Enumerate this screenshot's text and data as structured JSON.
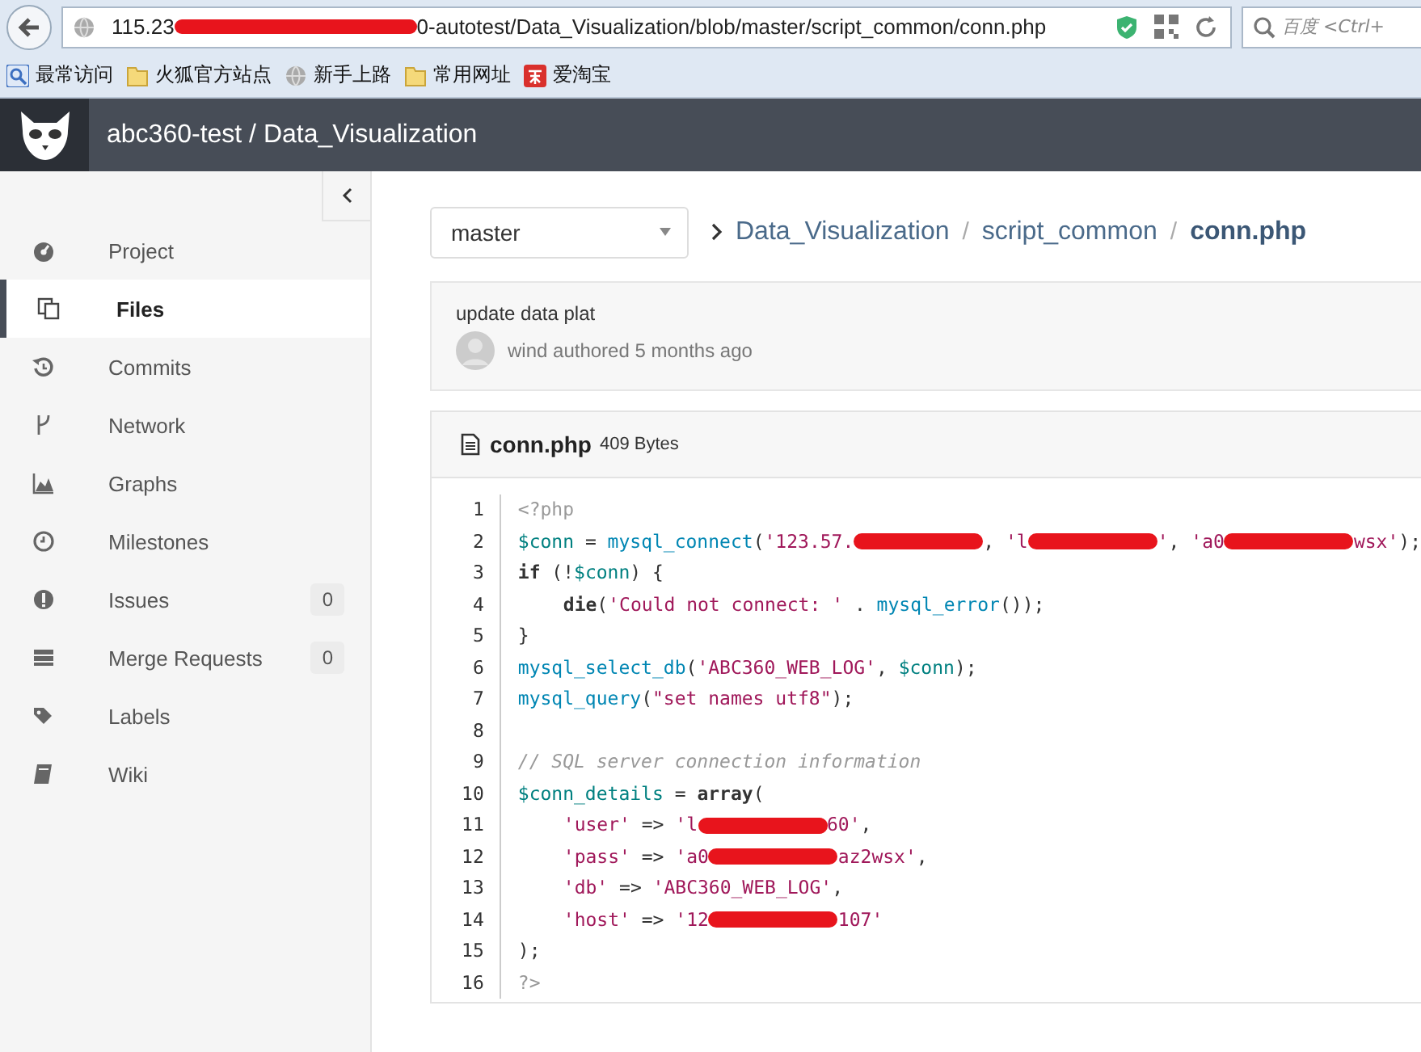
{
  "browser": {
    "address": [
      {
        "kind": "text",
        "text": "115.23"
      },
      {
        "kind": "redacted"
      },
      {
        "kind": "text",
        "text": "0-autotest/Data_Visualization/blob/master/script_common/conn.php"
      }
    ],
    "search": {
      "placeholder": "百度 <Ctrl+"
    },
    "bookmarks": [
      {
        "kind": "search",
        "label": "最常访问"
      },
      {
        "kind": "folder",
        "label": "火狐官方站点"
      },
      {
        "kind": "globe",
        "label": "新手上路"
      },
      {
        "kind": "folder",
        "label": "常用网址"
      },
      {
        "kind": "taobao",
        "label": "爱淘宝"
      }
    ]
  },
  "header": {
    "title": "abc360-test / Data_Visualization"
  },
  "sidebar": {
    "items": [
      {
        "kind": "dashboard",
        "label": "Project",
        "selected": false
      },
      {
        "kind": "files",
        "label": "Files",
        "selected": true
      },
      {
        "kind": "history",
        "label": "Commits",
        "selected": false
      },
      {
        "kind": "fork",
        "label": "Network",
        "selected": false
      },
      {
        "kind": "chart",
        "label": "Graphs",
        "selected": false
      },
      {
        "kind": "clock",
        "label": "Milestones",
        "selected": false
      },
      {
        "kind": "info",
        "label": "Issues",
        "selected": false,
        "count": "0"
      },
      {
        "kind": "list",
        "label": "Merge Requests",
        "selected": false,
        "count": "0"
      },
      {
        "kind": "tags",
        "label": "Labels",
        "selected": false
      },
      {
        "kind": "book",
        "label": "Wiki",
        "selected": false
      }
    ]
  },
  "branch": {
    "value": "master"
  },
  "breadcrumb": [
    {
      "text": "Data_Visualization",
      "current": false
    },
    {
      "separator": "/",
      "text": "script_common",
      "current": false
    },
    {
      "separator": "/",
      "text": "conn.php",
      "current": true
    }
  ],
  "commit": {
    "message": "update data plat",
    "meta": "wind authored 5 months ago"
  },
  "file": {
    "name": "conn.php",
    "size": "409 Bytes",
    "lines": [
      {
        "number": "1",
        "tokens": [
          {
            "kind": "meta",
            "text": "<?php"
          }
        ]
      },
      {
        "number": "2",
        "tokens": [
          {
            "kind": "var",
            "text": "$conn"
          },
          {
            "kind": "plain",
            "text": " = "
          },
          {
            "kind": "func",
            "text": "mysql_connect"
          },
          {
            "kind": "plain",
            "text": "("
          },
          {
            "kind": "string",
            "text": "'123.57."
          },
          {
            "kind": "redacted"
          },
          {
            "kind": "plain",
            "text": ", "
          },
          {
            "kind": "string",
            "text": "'l"
          },
          {
            "kind": "redacted"
          },
          {
            "kind": "string",
            "text": "'"
          },
          {
            "kind": "plain",
            "text": ", "
          },
          {
            "kind": "string",
            "text": "'a0"
          },
          {
            "kind": "redacted"
          },
          {
            "kind": "string",
            "text": "wsx'"
          },
          {
            "kind": "plain",
            "text": ");"
          }
        ]
      },
      {
        "number": "3",
        "tokens": [
          {
            "kind": "keyword",
            "text": "if"
          },
          {
            "kind": "plain",
            "text": " (!"
          },
          {
            "kind": "var",
            "text": "$conn"
          },
          {
            "kind": "plain",
            "text": ") {"
          }
        ]
      },
      {
        "number": "4",
        "indented": true,
        "tokens": [
          {
            "kind": "keyword",
            "text": "die"
          },
          {
            "kind": "plain",
            "text": "("
          },
          {
            "kind": "string",
            "text": "'Could not connect: '"
          },
          {
            "kind": "plain",
            "text": " . "
          },
          {
            "kind": "func",
            "text": "mysql_error"
          },
          {
            "kind": "plain",
            "text": "());"
          }
        ]
      },
      {
        "number": "5",
        "tokens": [
          {
            "kind": "plain",
            "text": "}"
          }
        ]
      },
      {
        "number": "6",
        "tokens": [
          {
            "kind": "func",
            "text": "mysql_select_db"
          },
          {
            "kind": "plain",
            "text": "("
          },
          {
            "kind": "string",
            "text": "'ABC360_WEB_LOG'"
          },
          {
            "kind": "plain",
            "text": ", "
          },
          {
            "kind": "var",
            "text": "$conn"
          },
          {
            "kind": "plain",
            "text": ");"
          }
        ]
      },
      {
        "number": "7",
        "tokens": [
          {
            "kind": "func",
            "text": "mysql_query"
          },
          {
            "kind": "plain",
            "text": "("
          },
          {
            "kind": "string",
            "text": "\"set names utf8\""
          },
          {
            "kind": "plain",
            "text": ");"
          }
        ]
      },
      {
        "number": "8"
      },
      {
        "number": "9",
        "tokens": [
          {
            "kind": "comment",
            "text": "// SQL server connection information"
          }
        ]
      },
      {
        "number": "10",
        "tokens": [
          {
            "kind": "var",
            "text": "$conn_details"
          },
          {
            "kind": "plain",
            "text": " = "
          },
          {
            "kind": "keyword",
            "text": "array"
          },
          {
            "kind": "plain",
            "text": "("
          }
        ]
      },
      {
        "number": "11",
        "indented": true,
        "tokens": [
          {
            "kind": "string",
            "text": "'user'"
          },
          {
            "kind": "plain",
            "text": " => "
          },
          {
            "kind": "string",
            "text": "'l"
          },
          {
            "kind": "redacted"
          },
          {
            "kind": "string",
            "text": "60'"
          },
          {
            "kind": "plain",
            "text": ","
          }
        ]
      },
      {
        "number": "12",
        "indented": true,
        "tokens": [
          {
            "kind": "string",
            "text": "'pass'"
          },
          {
            "kind": "plain",
            "text": " => "
          },
          {
            "kind": "string",
            "text": "'a0"
          },
          {
            "kind": "redacted"
          },
          {
            "kind": "string",
            "text": "az2wsx'"
          },
          {
            "kind": "plain",
            "text": ","
          }
        ]
      },
      {
        "number": "13",
        "indented": true,
        "tokens": [
          {
            "kind": "string",
            "text": "'db'"
          },
          {
            "kind": "plain",
            "text": " => "
          },
          {
            "kind": "string",
            "text": "'ABC360_WEB_LOG'"
          },
          {
            "kind": "plain",
            "text": ","
          }
        ]
      },
      {
        "number": "14",
        "indented": true,
        "tokens": [
          {
            "kind": "string",
            "text": "'host'"
          },
          {
            "kind": "plain",
            "text": " => "
          },
          {
            "kind": "string",
            "text": "'12"
          },
          {
            "kind": "redacted"
          },
          {
            "kind": "string",
            "text": "107'"
          }
        ]
      },
      {
        "number": "15",
        "tokens": [
          {
            "kind": "plain",
            "text": ");"
          }
        ]
      },
      {
        "number": "16",
        "tokens": [
          {
            "kind": "meta",
            "text": "?>"
          }
        ]
      }
    ]
  }
}
